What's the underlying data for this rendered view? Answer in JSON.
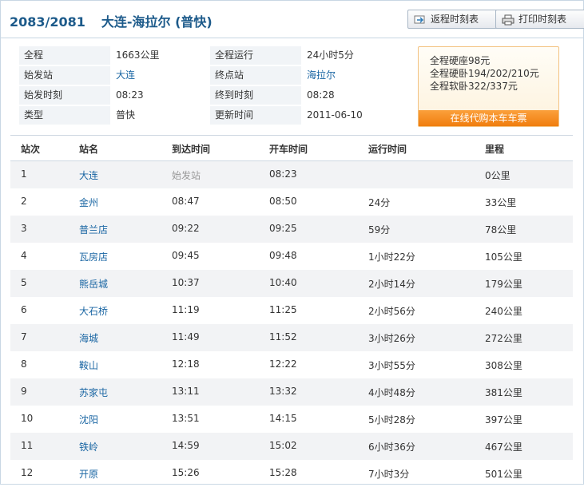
{
  "header": {
    "train_no": "2083/2081",
    "route": "大连-海拉尔 (普快)",
    "return_button": "返程时刻表",
    "print_button": "打印时刻表"
  },
  "info": {
    "rows": [
      {
        "label1": "全程",
        "value1": "1663公里",
        "label2": "全程运行",
        "value2": "24小时5分"
      },
      {
        "label1": "始发站",
        "value1": "大连",
        "label2": "终点站",
        "value2": "海拉尔"
      },
      {
        "label1": "始发时刻",
        "value1": "08:23",
        "label2": "终到时刻",
        "value2": "08:28"
      },
      {
        "label1": "类型",
        "value1": "普快",
        "label2": "更新时间",
        "value2": "2011-06-10"
      }
    ]
  },
  "prices": {
    "hard_seat": "全程硬座98元",
    "hard_sleeper": "全程硬卧194/202/210元",
    "soft_sleeper": "全程软卧322/337元",
    "buy_button": "在线代购本车车票"
  },
  "table": {
    "headers": [
      "站次",
      "站名",
      "到达时间",
      "开车时间",
      "运行时间",
      "里程"
    ],
    "rows": [
      [
        "1",
        "大连",
        "始发站",
        "08:23",
        "",
        "0公里"
      ],
      [
        "2",
        "金州",
        "08:47",
        "08:50",
        "24分",
        "33公里"
      ],
      [
        "3",
        "普兰店",
        "09:22",
        "09:25",
        "59分",
        "78公里"
      ],
      [
        "4",
        "瓦房店",
        "09:45",
        "09:48",
        "1小时22分",
        "105公里"
      ],
      [
        "5",
        "熊岳城",
        "10:37",
        "10:40",
        "2小时14分",
        "179公里"
      ],
      [
        "6",
        "大石桥",
        "11:19",
        "11:25",
        "2小时56分",
        "240公里"
      ],
      [
        "7",
        "海城",
        "11:49",
        "11:52",
        "3小时26分",
        "272公里"
      ],
      [
        "8",
        "鞍山",
        "12:18",
        "12:22",
        "3小时55分",
        "308公里"
      ],
      [
        "9",
        "苏家屯",
        "13:11",
        "13:32",
        "4小时48分",
        "381公里"
      ],
      [
        "10",
        "沈阳",
        "13:51",
        "14:15",
        "5小时28分",
        "397公里"
      ],
      [
        "11",
        "铁岭",
        "14:59",
        "15:02",
        "6小时36分",
        "467公里"
      ],
      [
        "12",
        "开原",
        "15:26",
        "15:28",
        "7小时3分",
        "501公里"
      ]
    ]
  },
  "colors": {
    "title": "#1c5a8a",
    "link": "#1a66a3",
    "accent_orange": "#f07d0e",
    "row_alt": "#f2f3f5"
  }
}
